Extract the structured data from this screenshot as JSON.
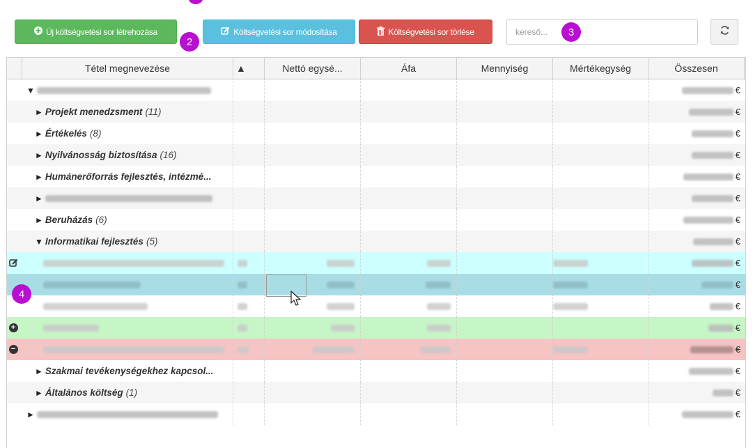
{
  "toolbar": {
    "create_label": "Új költségvetési sor létrehozása",
    "modify_label": "Költségvetési sor módosítása",
    "delete_label": "Költségvetési sor törlése",
    "search_placeholder": "kereső...",
    "refresh_icon": "refresh-icon"
  },
  "annotations": {
    "badge_2": "2",
    "badge_3": "3",
    "badge_4": "4"
  },
  "columns": {
    "name": "Tétel megnevezése",
    "sort": "▲",
    "unit_net": "Nettó egysé...",
    "vat": "Áfa",
    "quantity": "Mennyiség",
    "unit": "Mértékegység",
    "total": "Összesen"
  },
  "currency": "€",
  "rows": [
    {
      "type": "root",
      "triangle": "▼"
    },
    {
      "type": "group",
      "triangle": "►",
      "label": "Projekt menedzsment",
      "count": "(11)"
    },
    {
      "type": "group",
      "triangle": "►",
      "label": "Értékelés",
      "count": "(8)"
    },
    {
      "type": "group",
      "triangle": "►",
      "label": "Nyilvánosság biztosítása",
      "count": "(16)"
    },
    {
      "type": "group",
      "triangle": "►",
      "label": "Humánerőforrás fejlesztés, intézmé..."
    },
    {
      "type": "group-blurred",
      "triangle": "►"
    },
    {
      "type": "group",
      "triangle": "►",
      "label": "Beruházás",
      "count": "(6)"
    },
    {
      "type": "group",
      "triangle": "▼",
      "label": "Informatikai fejlesztés",
      "count": "(5)"
    },
    {
      "type": "item",
      "state": "edited"
    },
    {
      "type": "item",
      "state": "selected"
    },
    {
      "type": "item",
      "state": "normal"
    },
    {
      "type": "item",
      "state": "added"
    },
    {
      "type": "item",
      "state": "deleted"
    },
    {
      "type": "group",
      "triangle": "►",
      "label": "Szakmai tevékenységekhez kapcsol..."
    },
    {
      "type": "group",
      "triangle": "►",
      "label": "Általános költség",
      "count": "(1)"
    },
    {
      "type": "root",
      "triangle": "►"
    }
  ],
  "colors": {
    "create": "#5cb85c",
    "modify": "#5bc0de",
    "delete": "#d9534f",
    "badge": "#b80fd1",
    "edited_row": "#ccffff",
    "selected_row": "#a9dde6",
    "added_row": "#c6f5c6",
    "deleted_row": "#f7c4c4"
  }
}
